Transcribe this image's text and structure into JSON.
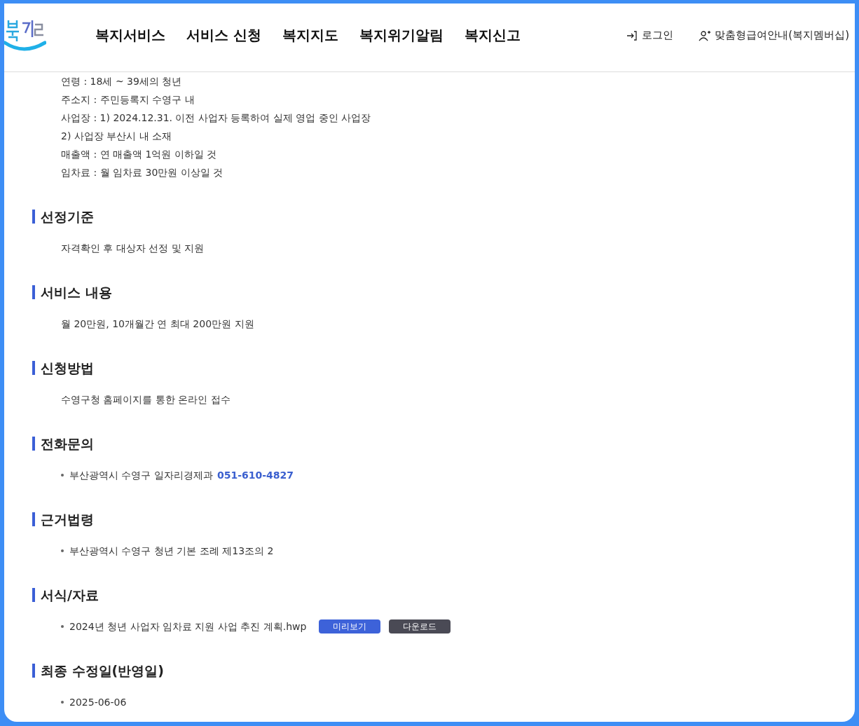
{
  "header": {
    "nav": [
      {
        "label": "복지서비스"
      },
      {
        "label": "서비스 신청"
      },
      {
        "label": "복지지도"
      },
      {
        "label": "복지위기알림"
      },
      {
        "label": "복지신고"
      }
    ],
    "login": "로그인",
    "membership": "맞춤형급여안내(복지멤버십)"
  },
  "sections": [
    {
      "items": [
        {
          "kind": "plain",
          "text": "연령 : 18세 ~ 39세의 청년"
        },
        {
          "kind": "plain",
          "text": "주소지 : 주민등록지 수영구 내"
        },
        {
          "kind": "plain",
          "text": "사업장 : 1) 2024.12.31. 이전 사업자 등록하여 실제 영업 중인 사업장"
        },
        {
          "kind": "plain",
          "text": "2) 사업장 부산시 내 소재"
        },
        {
          "kind": "plain",
          "text": "매출액 : 연 매출액 1억원 이하일 것"
        },
        {
          "kind": "plain",
          "text": "임차료 : 월 임차료 30만원 이상일 것"
        }
      ]
    },
    {
      "title": "선정기준",
      "items": [
        {
          "kind": "plain",
          "text": "자격확인 후 대상자 선정 및 지원"
        }
      ]
    },
    {
      "title": "서비스 내용",
      "items": [
        {
          "kind": "plain",
          "text": "월 20만원, 10개월간 연 최대 200만원 지원"
        }
      ]
    },
    {
      "title": "신청방법",
      "items": [
        {
          "kind": "plain",
          "text": "수영구청 홈페이지를 통한 온라인 접수"
        }
      ]
    },
    {
      "title": "전화문의",
      "items": [
        {
          "kind": "bullet",
          "text": "부산광역시 수영구 일자리경제과",
          "phone": "051-610-4827"
        }
      ]
    },
    {
      "title": "근거법령",
      "items": [
        {
          "kind": "bullet",
          "text": "부산광역시 수영구 청년 기본 조례 제13조의 2"
        }
      ]
    },
    {
      "title": "서식/자료",
      "items": [
        {
          "kind": "bullet",
          "text": "2024년 청년 사업자 임차료 지원 사업 추진 계획.hwp",
          "buttons": [
            {
              "kind": "preview",
              "label": "미리보기"
            },
            {
              "kind": "download",
              "label": "다운로드"
            }
          ]
        }
      ]
    },
    {
      "title": "최종 수정일(반영일)",
      "items": [
        {
          "kind": "bullet",
          "text": "2025-06-06"
        }
      ]
    }
  ]
}
